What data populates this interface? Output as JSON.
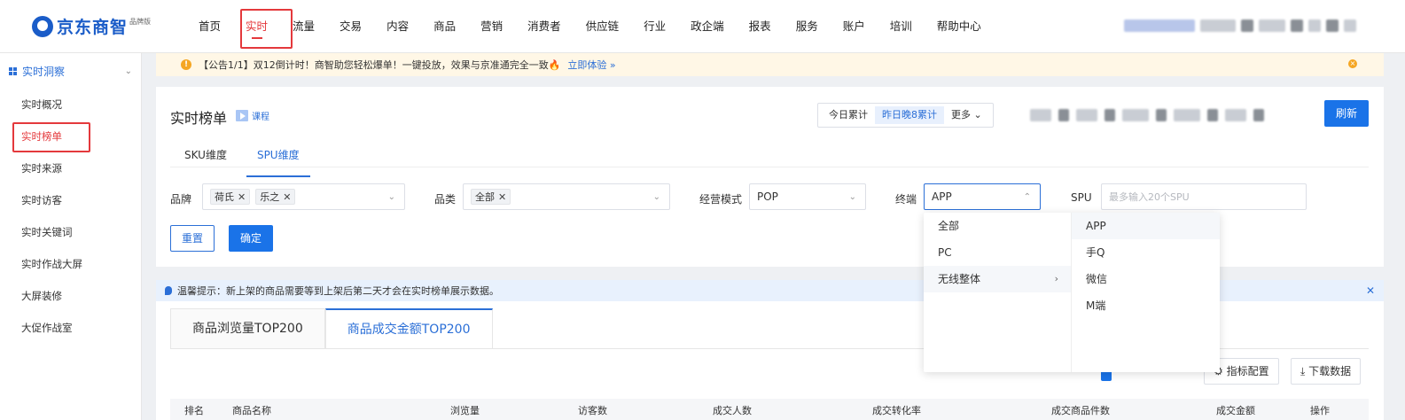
{
  "app": {
    "logo_text": "京东商智",
    "logo_sub": "品牌版"
  },
  "nav": {
    "items": [
      "首页",
      "实时",
      "流量",
      "交易",
      "内容",
      "商品",
      "营销",
      "消费者",
      "供应链",
      "行业",
      "政企端",
      "报表",
      "服务",
      "账户",
      "培训",
      "帮助中心"
    ],
    "active": "实时"
  },
  "sidebar": {
    "section": "实时洞察",
    "items": [
      "实时概况",
      "实时榜单",
      "实时来源",
      "实时访客",
      "实时关键词",
      "实时作战大屏",
      "大屏装修",
      "大促作战室"
    ],
    "active": "实时榜单"
  },
  "notice": {
    "text": "【公告1/1】双12倒计时！商智助您轻松爆单！一键投放，效果与京准通完全一致🔥",
    "link": "立即体验 »"
  },
  "panel": {
    "title": "实时榜单",
    "course": "课程",
    "seg": [
      "今日累计",
      "昨日晚8累计",
      "更多 ⌄"
    ],
    "seg_active": "昨日晚8累计",
    "refresh": "刷新",
    "dim_tabs": [
      "SKU维度",
      "SPU维度"
    ],
    "dim_active": "SPU维度"
  },
  "filters": {
    "brand_label": "品牌",
    "brand_tags": [
      "荷氏",
      "乐之"
    ],
    "category_label": "品类",
    "category_tags": [
      "全部"
    ],
    "mode_label": "经营模式",
    "mode_value": "POP",
    "terminal_label": "终端",
    "terminal_value": "APP",
    "spu_label": "SPU",
    "spu_placeholder": "最多输入20个SPU",
    "reset": "重置",
    "confirm": "确定"
  },
  "tip": {
    "text": "温馨提示：新上架的商品需要等到上架后第二天才会在实时榜单展示数据。"
  },
  "lower": {
    "tabs": [
      "商品浏览量TOP200",
      "商品成交金额TOP200"
    ],
    "active": "商品成交金额TOP200",
    "metric_btn": "⚙ 指标配置",
    "download_btn": "⤓ 下载数据",
    "headers": [
      "排名",
      "商品名称",
      "浏览量",
      "访客数",
      "成交人数",
      "成交转化率",
      "成交商品件数",
      "成交金额",
      "操作"
    ]
  },
  "dropdown": {
    "left": [
      "全部",
      "PC",
      "无线整体"
    ],
    "right": [
      "APP",
      "手Q",
      "微信",
      "M端"
    ]
  },
  "colors": {
    "accent": "#1a73e8",
    "brand_red": "#e4393c",
    "notice_bg": "#fff7e6"
  }
}
